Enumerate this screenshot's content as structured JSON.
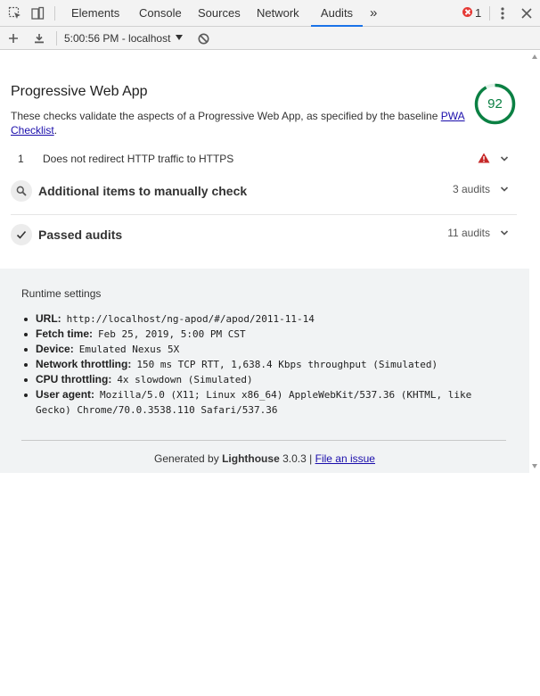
{
  "tabs": {
    "elements": "Elements",
    "console": "Console",
    "sources": "Sources",
    "network": "Network",
    "audits": "Audits",
    "more": "»"
  },
  "errors": {
    "count": "1"
  },
  "toolbar": {
    "session": "5:00:56 PM - localhost"
  },
  "report": {
    "category_title": "Progressive Web App",
    "score": "92",
    "score_color": "#0b8043",
    "description_prefix": "These checks validate the aspects of a Progressive Web App, as specified by the baseline",
    "description_link": "PWA Checklist",
    "description_suffix": ".",
    "failed_audits": [
      {
        "index": "1",
        "title": "Does not redirect HTTP traffic to HTTPS"
      }
    ],
    "groups": [
      {
        "title": "Additional items to manually check",
        "count": "3 audits"
      },
      {
        "title": "Passed audits",
        "count": "11 audits"
      }
    ]
  },
  "runtime": {
    "title": "Runtime settings",
    "items": [
      {
        "label": "URL:",
        "value": "http://localhost/ng-apod/#/apod/2011-11-14"
      },
      {
        "label": "Fetch time:",
        "value": "Feb 25, 2019, 5:00 PM CST"
      },
      {
        "label": "Device:",
        "value": "Emulated Nexus 5X"
      },
      {
        "label": "Network throttling:",
        "value": "150 ms TCP RTT, 1,638.4 Kbps throughput (Simulated)"
      },
      {
        "label": "CPU throttling:",
        "value": "4x slowdown (Simulated)"
      },
      {
        "label": "User agent:",
        "value": "Mozilla/5.0 (X11; Linux x86_64) AppleWebKit/537.36 (KHTML, like Gecko) Chrome/70.0.3538.110 Safari/537.36"
      }
    ]
  },
  "footer": {
    "generated_by": "Generated by",
    "tool": "Lighthouse",
    "version": "3.0.3",
    "separator": "|",
    "issue_link": "File an issue"
  }
}
